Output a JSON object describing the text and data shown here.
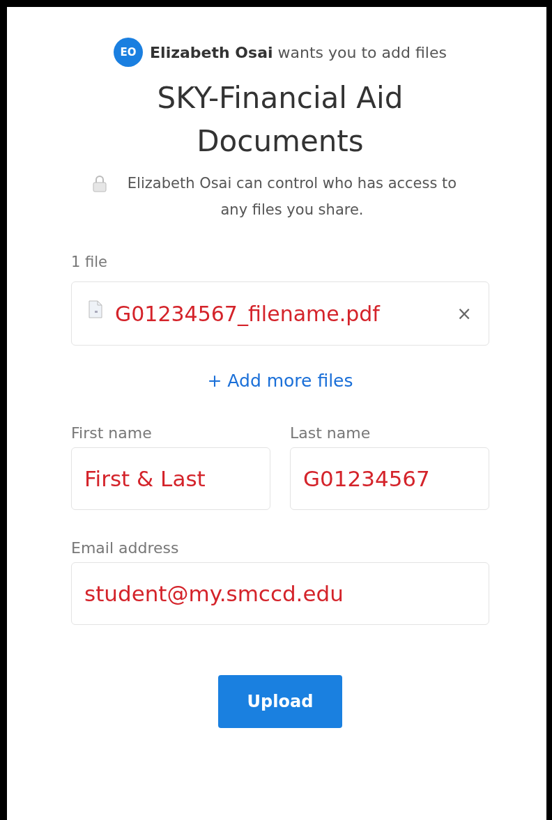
{
  "request": {
    "avatar_initials": "EO",
    "message": "**Elizabeth Osai** wants you to add files"
  },
  "title": "SKY-Financial Aid Documents",
  "notice": "Elizabeth Osai can control who has access to any files you share.",
  "files": {
    "count_label": "1 file",
    "items": [
      {
        "name": "G01234567_filename.pdf",
        "remove": "×"
      }
    ],
    "add_more": "+ Add more files"
  },
  "form": {
    "first_name": {
      "label": "First name",
      "value": "First & Last"
    },
    "last_name": {
      "label": "Last name",
      "value": "G01234567"
    },
    "email": {
      "label": "Email address",
      "value": "student@my.smccd.edu"
    }
  },
  "submit": "Upload"
}
